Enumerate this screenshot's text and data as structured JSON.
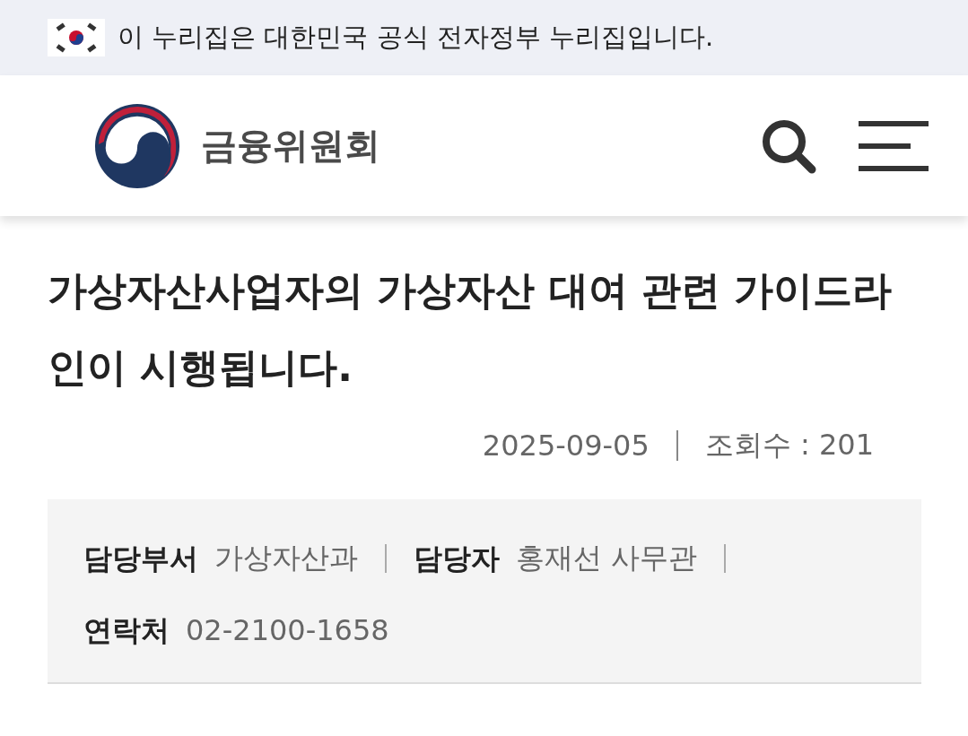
{
  "banner": {
    "text": "이 누리집은 대한민국 공식 전자정부 누리집입니다."
  },
  "header": {
    "logo_text": "금융위원회"
  },
  "article": {
    "title": "가상자산사업자의 가상자산 대여 관련 가이드라인이 시행됩니다.",
    "date": "2025-09-05",
    "views_label": "조회수 : 201"
  },
  "info": [
    {
      "label": "담당부서",
      "value": "가상자산과"
    },
    {
      "label": "담당자",
      "value": "홍재선 사무관"
    },
    {
      "label": "연락처",
      "value": "02-2100-1658"
    }
  ]
}
